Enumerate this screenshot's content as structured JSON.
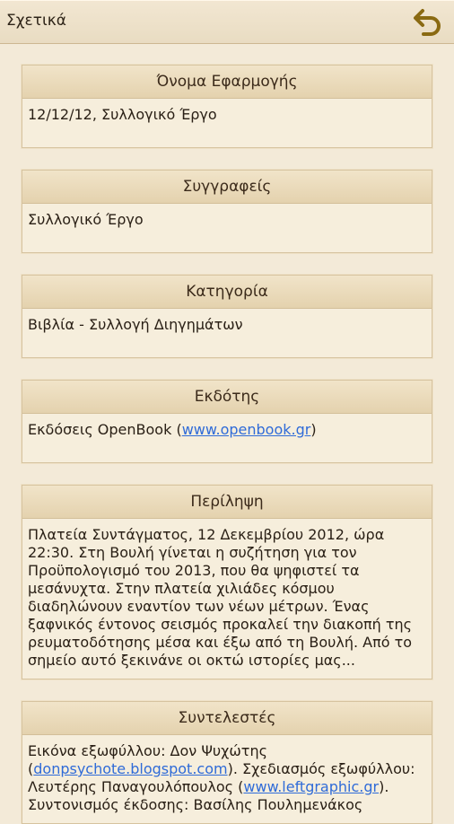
{
  "header": {
    "title": "Σχετικά",
    "back_icon": "back-arrow-icon"
  },
  "sections": {
    "app_name": {
      "title": "Όνομα Εφαρμογής",
      "text": "12/12/12, Συλλογικό Έργο"
    },
    "authors": {
      "title": "Συγγραφείς",
      "text": "Συλλογικό Έργο"
    },
    "category": {
      "title": "Κατηγορία",
      "text": "Βιβλία - Συλλογή Διηγημάτων"
    },
    "publisher": {
      "title": "Εκδότης",
      "prefix": "Εκδόσεις OpenBook (",
      "link": "www.openbook.gr",
      "suffix": ")"
    },
    "summary": {
      "title": "Περίληψη",
      "text": "Πλατεία Συντάγματος, 12 Δεκεμβρίου 2012, ώρα 22:30. Στη Βουλή γίνεται η συζήτηση για τον Προϋπολογισμό του 2013, που θα ψηφιστεί τα μεσάνυχτα. Στην πλατεία χιλιάδες κόσμου διαδηλώνουν εναντίον των νέων μέτρων. Ένας ξαφνικός έντονος σεισμός προκαλεί την διακοπή της ρευματοδότησης μέσα και έξω από τη Βουλή. Από το σημείο αυτό ξεκινάνε οι οκτώ ιστορίες μας..."
    },
    "credits": {
      "title": "Συντελεστές",
      "cover_image_label": "Εικόνα εξωφύλλου: Δον Ψυχώτης (",
      "cover_image_link": "donpsychote.blogspot.com",
      "cover_design_label": "). Σχεδιασμός εξωφύλλου: Λευτέρης Παναγουλόπουλος (",
      "cover_design_link": "www.leftgraphic.gr",
      "cover_design_end": ").",
      "coordination": "Συντονισμός έκδοσης: Βασίλης Πουλημενάκος"
    }
  },
  "colors": {
    "background": "#f3ead8",
    "header": "#e9dcc2",
    "link": "#2f6bd8",
    "back_icon": "#8a6a12"
  }
}
